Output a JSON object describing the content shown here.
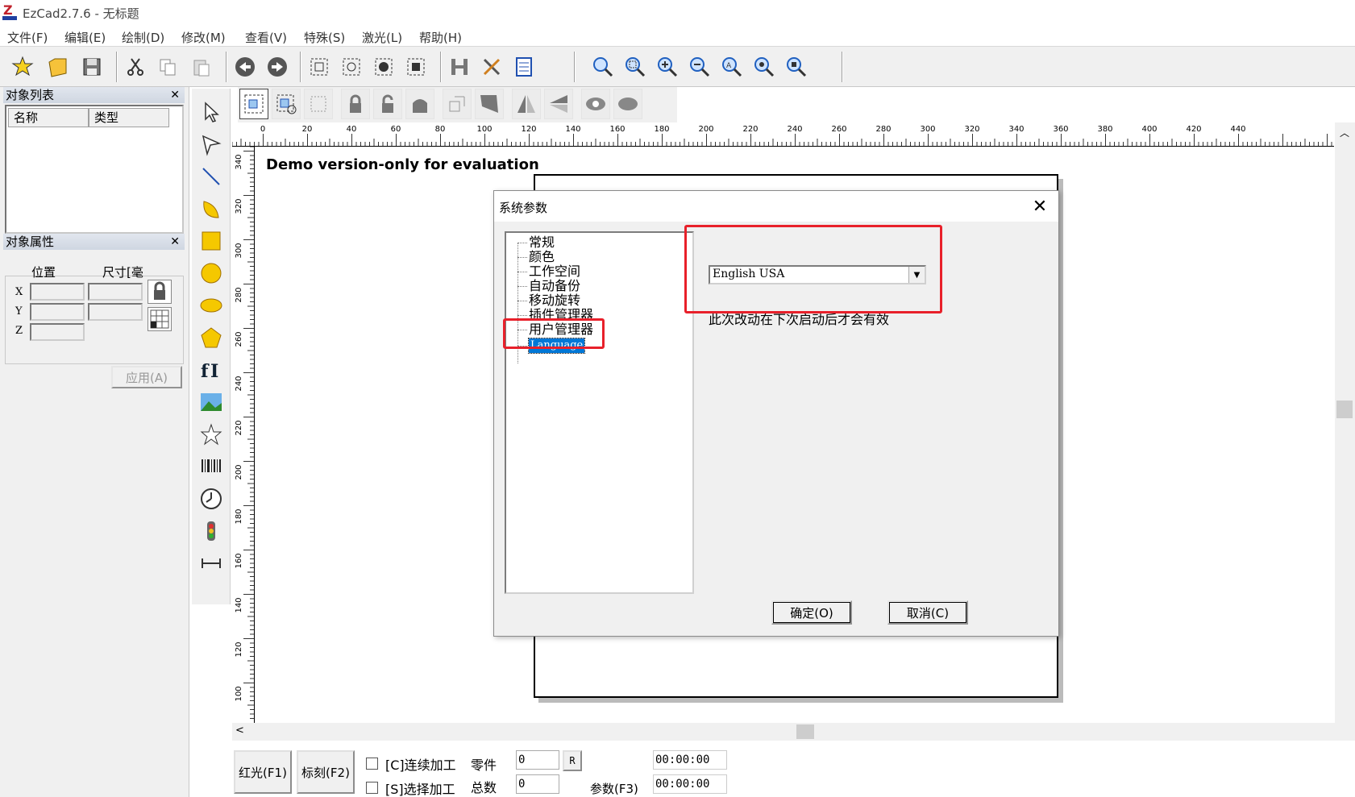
{
  "app": {
    "title": "EzCad2.7.6 - 无标题",
    "menu": [
      "文件(F)",
      "编辑(E)",
      "绘制(D)",
      "修改(M)",
      "查看(V)",
      "特殊(S)",
      "激光(L)",
      "帮助(H)"
    ]
  },
  "left_panel": {
    "object_list_title": "对象列表",
    "object_list_columns": [
      "名称",
      "类型"
    ],
    "object_props_title": "对象属性",
    "position_label": "位置",
    "size_label": "尺寸[毫",
    "axes": [
      "X",
      "Y",
      "Z"
    ],
    "apply_button": "应用(A)"
  },
  "canvas": {
    "demo_text": "Demo version-only for evaluation",
    "ruler_h_labels": [
      "0",
      "20",
      "40",
      "60",
      "80",
      "100",
      "120",
      "140",
      "160",
      "180",
      "200",
      "220",
      "240",
      "260",
      "280",
      "300",
      "320",
      "340",
      "360",
      "380",
      "400",
      "420",
      "440"
    ],
    "ruler_v_labels": [
      "340",
      "320",
      "300",
      "280",
      "260",
      "240",
      "220",
      "200",
      "180",
      "160",
      "140",
      "120",
      "100"
    ]
  },
  "dialog": {
    "title": "系统参数",
    "close": "✕",
    "tree_items": [
      "常规",
      "颜色",
      "工作空间",
      "自动备份",
      "移动旋转",
      "插件管理器",
      "用户管理器",
      "Language"
    ],
    "language_value": "English USA",
    "restart_note": "此次改动在下次启动后才会有效",
    "ok_button": "确定(O)",
    "cancel_button": "取消(C)",
    "highlight_color": "#e8202a"
  },
  "bottom": {
    "red_light_button": "红光(F1)",
    "mark_button": "标刻(F2)",
    "continuous_label": "[C]连续加工",
    "select_label": "[S]选择加工",
    "parts_label": "零件",
    "total_label": "总数",
    "parts_value": "0",
    "total_value": "0",
    "reset_button": "R",
    "params_button": "参数(F3)",
    "time1": "00:00:00",
    "time2": "00:00:00"
  }
}
